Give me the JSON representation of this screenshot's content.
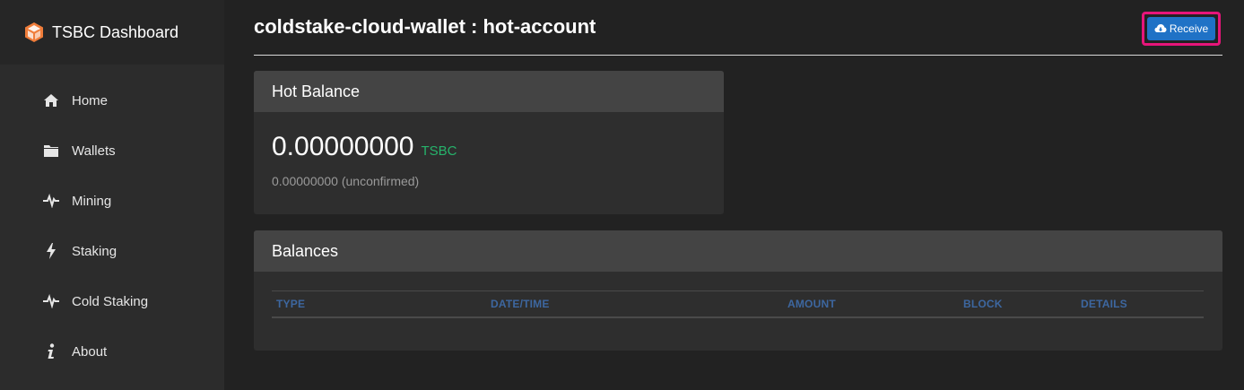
{
  "brand": {
    "title": "TSBC Dashboard",
    "logo_icon": "tsbc-cube-logo"
  },
  "sidebar": {
    "items": [
      {
        "label": "Home",
        "icon": "home-icon"
      },
      {
        "label": "Wallets",
        "icon": "folder-icon"
      },
      {
        "label": "Mining",
        "icon": "pulse-icon"
      },
      {
        "label": "Staking",
        "icon": "lightning-icon"
      },
      {
        "label": "Cold Staking",
        "icon": "pulse-icon"
      },
      {
        "label": "About",
        "icon": "info-icon"
      }
    ]
  },
  "header": {
    "title": "coldstake-cloud-wallet : hot-account",
    "receive_label": "Receive",
    "receive_icon": "cloud-download-icon"
  },
  "hot_balance": {
    "title": "Hot Balance",
    "value": "0.00000000",
    "unit": "TSBC",
    "unconfirmed": "0.00000000 (unconfirmed)"
  },
  "balances": {
    "title": "Balances",
    "columns": [
      "TYPE",
      "DATE/TIME",
      "AMOUNT",
      "BLOCK",
      "DETAILS"
    ],
    "rows": []
  },
  "colors": {
    "accent_blue": "#1f72c6",
    "highlight_pink": "#e6157a",
    "unit_green": "#26b36b",
    "column_header_blue": "#3d67a0"
  }
}
